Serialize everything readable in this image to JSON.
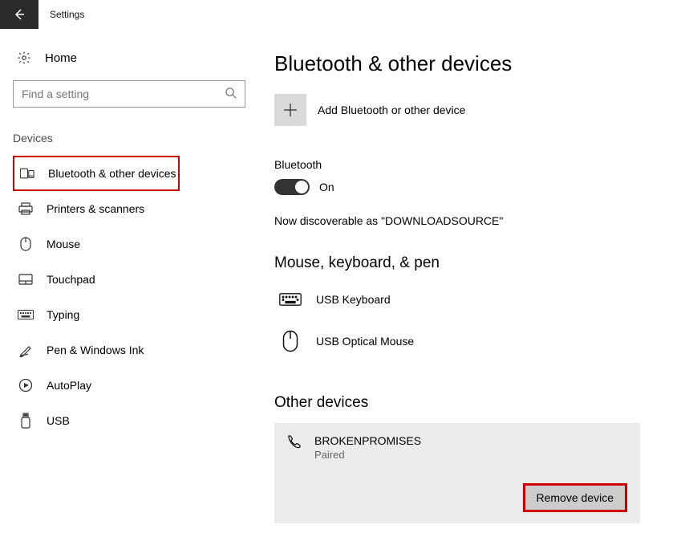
{
  "window": {
    "title": "Settings"
  },
  "home": {
    "label": "Home"
  },
  "search": {
    "placeholder": "Find a setting"
  },
  "sidebar": {
    "section_title": "Devices",
    "items": [
      {
        "label": "Bluetooth & other devices"
      },
      {
        "label": "Printers & scanners"
      },
      {
        "label": "Mouse"
      },
      {
        "label": "Touchpad"
      },
      {
        "label": "Typing"
      },
      {
        "label": "Pen & Windows Ink"
      },
      {
        "label": "AutoPlay"
      },
      {
        "label": "USB"
      }
    ]
  },
  "main": {
    "title": "Bluetooth & other devices",
    "add_label": "Add Bluetooth or other device",
    "bluetooth_label": "Bluetooth",
    "toggle_state_label": "On",
    "discoverable_text": "Now discoverable as \"DOWNLOADSOURCE\"",
    "section_mouse_kb": "Mouse, keyboard, & pen",
    "devices_mk": [
      {
        "name": "USB Keyboard"
      },
      {
        "name": "USB Optical Mouse"
      }
    ],
    "section_other": "Other devices",
    "other_selected": {
      "name": "BROKENPROMISES",
      "status": "Paired"
    },
    "remove_label": "Remove device"
  }
}
